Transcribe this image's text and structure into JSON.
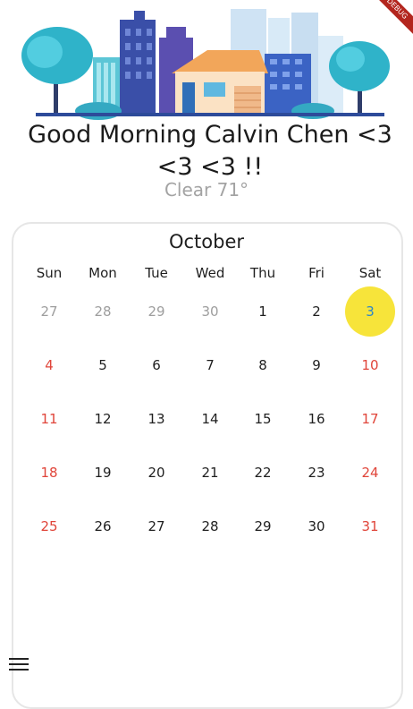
{
  "header": {
    "greeting": "Good Morning Calvin Chen <3 <3 <3 !!",
    "weather": "Clear 71°",
    "debug_banner": "DEBUG"
  },
  "calendar": {
    "month": "October",
    "weekdays": [
      "Sun",
      "Mon",
      "Tue",
      "Wed",
      "Thu",
      "Fri",
      "Sat"
    ],
    "weeks": [
      [
        {
          "d": "27",
          "s": "muted"
        },
        {
          "d": "28",
          "s": "muted"
        },
        {
          "d": "29",
          "s": "muted"
        },
        {
          "d": "30",
          "s": "muted"
        },
        {
          "d": "1",
          "s": ""
        },
        {
          "d": "2",
          "s": ""
        },
        {
          "d": "3",
          "s": "selected"
        }
      ],
      [
        {
          "d": "4",
          "s": "weekend"
        },
        {
          "d": "5",
          "s": ""
        },
        {
          "d": "6",
          "s": ""
        },
        {
          "d": "7",
          "s": ""
        },
        {
          "d": "8",
          "s": ""
        },
        {
          "d": "9",
          "s": ""
        },
        {
          "d": "10",
          "s": "weekend"
        }
      ],
      [
        {
          "d": "11",
          "s": "weekend"
        },
        {
          "d": "12",
          "s": ""
        },
        {
          "d": "13",
          "s": ""
        },
        {
          "d": "14",
          "s": ""
        },
        {
          "d": "15",
          "s": ""
        },
        {
          "d": "16",
          "s": ""
        },
        {
          "d": "17",
          "s": "weekend"
        }
      ],
      [
        {
          "d": "18",
          "s": "weekend"
        },
        {
          "d": "19",
          "s": ""
        },
        {
          "d": "20",
          "s": ""
        },
        {
          "d": "21",
          "s": ""
        },
        {
          "d": "22",
          "s": ""
        },
        {
          "d": "23",
          "s": ""
        },
        {
          "d": "24",
          "s": "weekend"
        }
      ],
      [
        {
          "d": "25",
          "s": "weekend"
        },
        {
          "d": "26",
          "s": ""
        },
        {
          "d": "27",
          "s": ""
        },
        {
          "d": "28",
          "s": ""
        },
        {
          "d": "29",
          "s": ""
        },
        {
          "d": "30",
          "s": ""
        },
        {
          "d": "31",
          "s": "weekend"
        }
      ]
    ],
    "colors": {
      "selected_bg": "#f7e43a",
      "selected_text": "#2e87c8",
      "weekend": "#e0453a",
      "muted": "#9e9e9e"
    }
  },
  "icons": {
    "hero": "city-illustration-icon",
    "menu": "hamburger-menu-icon"
  }
}
